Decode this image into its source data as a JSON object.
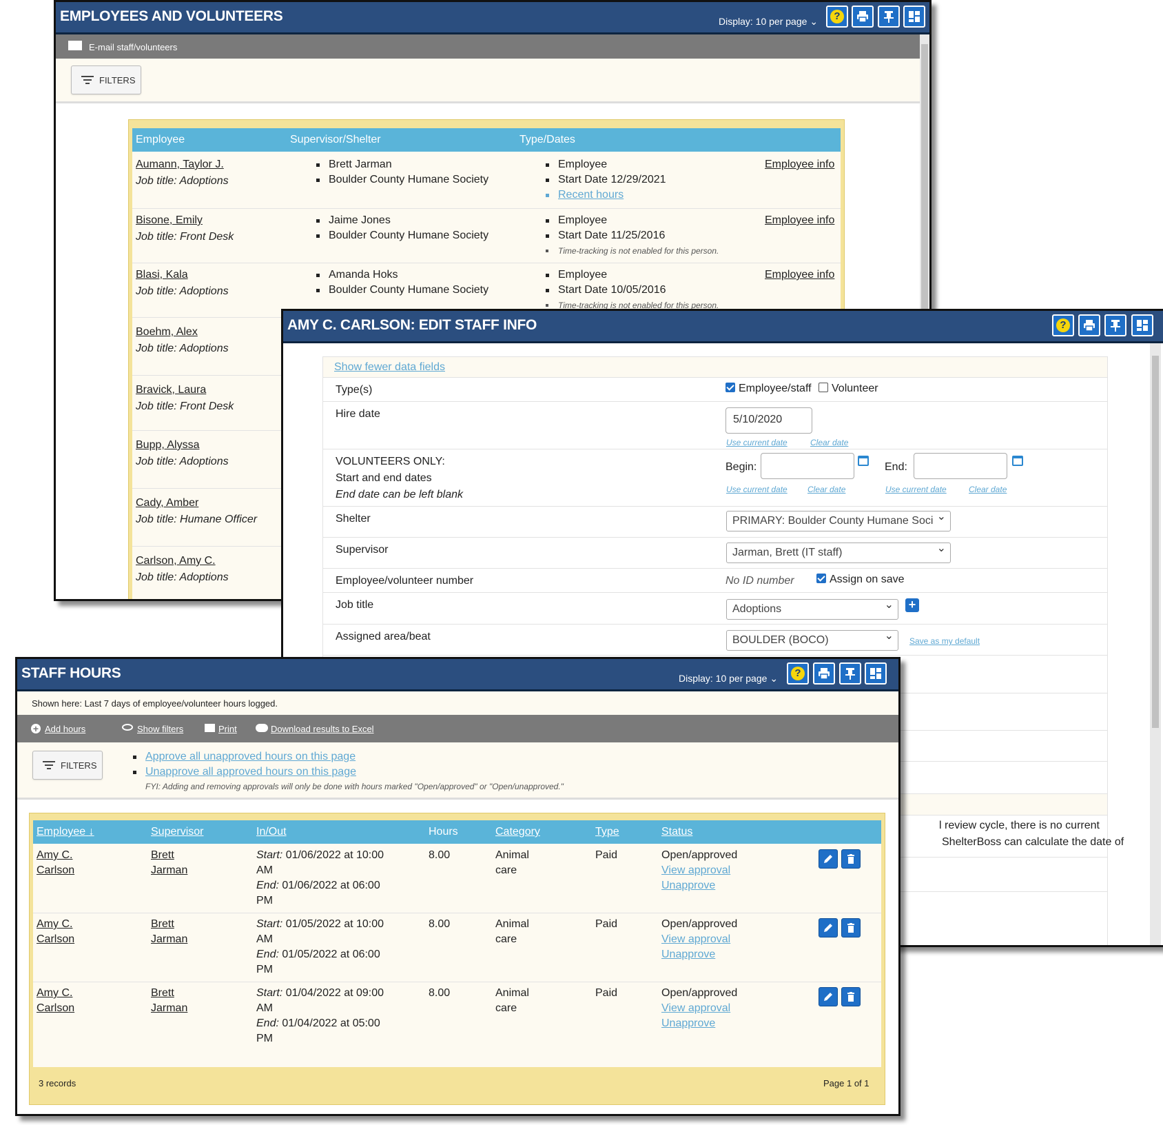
{
  "employees_window": {
    "title": "EMPLOYEES AND VOLUNTEERS",
    "display": "Display: 10 per page",
    "email_link": "E-mail staff/volunteers",
    "filters_label": "FILTERS",
    "columns": [
      "Employee",
      "Supervisor/Shelter",
      "Type/Dates"
    ],
    "rows": [
      {
        "name": "Aumann, Taylor J.",
        "job": "Job title: Adoptions",
        "supervisor": "Brett Jarman",
        "shelter": "Boulder County Humane Society",
        "type": "Employee",
        "start": "Start Date 12/29/2021",
        "extra": "Recent hours",
        "info": "Employee info"
      },
      {
        "name": "Bisone, Emily",
        "job": "Job title: Front Desk",
        "supervisor": "Jaime Jones",
        "shelter": "Boulder County Humane Society",
        "type": "Employee",
        "start": "Start Date 11/25/2016",
        "note": "Time-tracking is not enabled for this person.",
        "info": "Employee info"
      },
      {
        "name": "Blasi, Kala",
        "job": "Job title: Adoptions",
        "supervisor": "Amanda Hoks",
        "shelter": "Boulder County Humane Society",
        "type": "Employee",
        "start": "Start Date 10/05/2016",
        "note": "Time-tracking is not enabled for this person.",
        "info": "Employee info"
      },
      {
        "name": "Boehm, Alex",
        "job": "Job title: Adoptions"
      },
      {
        "name": "Bravick, Laura",
        "job": "Job title: Front Desk"
      },
      {
        "name": "Bupp, Alyssa",
        "job": "Job title: Adoptions"
      },
      {
        "name": "Cady, Amber",
        "job": "Job title: Humane Officer"
      },
      {
        "name": "Carlson, Amy C.",
        "job": "Job title: Adoptions"
      }
    ]
  },
  "edit_window": {
    "title": "AMY C. CARLSON: EDIT STAFF INFO",
    "show_fewer": "Show fewer data fields",
    "types_label": "Type(s)",
    "type_employee": "Employee/staff",
    "type_volunteer": "Volunteer",
    "hire_label": "Hire date",
    "hire_value": "5/10/2020",
    "use_current": "Use current date",
    "clear_date": "Clear date",
    "vol_line1": "VOLUNTEERS ONLY:",
    "vol_line2": "Start and end dates",
    "vol_line3": "End date can be left blank",
    "begin_label": "Begin:",
    "end_label": "End:",
    "shelter_label": "Shelter",
    "shelter_value": "PRIMARY: Boulder County Humane Soci",
    "supervisor_label": "Supervisor",
    "supervisor_value": "Jarman, Brett (IT staff)",
    "number_label": "Employee/volunteer number",
    "no_id": "No ID number",
    "assign_on_save": "Assign on save",
    "job_label": "Job title",
    "job_value": "Adoptions",
    "area_label": "Assigned area/beat",
    "area_value": "BOULDER (BOCO)",
    "save_default": "Save as my default",
    "review_line1": "l review cycle, there is no current",
    "review_line2": "ShelterBoss can calculate the date of"
  },
  "hours_window": {
    "title": "STAFF HOURS",
    "display": "Display: 10 per page",
    "shown_here": "Shown here: Last 7 days of employee/volunteer hours logged.",
    "toolbar": {
      "add": "Add hours",
      "filters": "Show filters",
      "print": "Print",
      "excel": "Download results to Excel"
    },
    "filters_label": "FILTERS",
    "approve_all": "Approve all unapproved hours on this page",
    "unapprove_all": "Unapprove all approved hours on this page",
    "fyi": "FYI: Adding and removing approvals will only be done with hours marked \"Open/approved\" or \"Open/unapproved.\"",
    "columns": {
      "employee": "Employee",
      "supervisor": "Supervisor",
      "inout": "In/Out",
      "hours": "Hours",
      "category": "Category",
      "type": "Type",
      "status": "Status"
    },
    "start_label": "Start:",
    "end_label": "End:",
    "rows": [
      {
        "emp1": "Amy C.",
        "emp2": "Carlson",
        "sup1": "Brett",
        "sup2": "Jarman",
        "start1": "01/06/2022 at 10:00",
        "start2": "AM",
        "end1": "01/06/2022 at 06:00",
        "end2": "PM",
        "hours": "8.00",
        "cat1": "Animal",
        "cat2": "care",
        "type": "Paid",
        "status": "Open/approved",
        "view": "View approval",
        "unapprove": "Unapprove"
      },
      {
        "emp1": "Amy C.",
        "emp2": "Carlson",
        "sup1": "Brett",
        "sup2": "Jarman",
        "start1": "01/05/2022 at 10:00",
        "start2": "AM",
        "end1": "01/05/2022 at 06:00",
        "end2": "PM",
        "hours": "8.00",
        "cat1": "Animal",
        "cat2": "care",
        "type": "Paid",
        "status": "Open/approved",
        "view": "View approval",
        "unapprove": "Unapprove"
      },
      {
        "emp1": "Amy C.",
        "emp2": "Carlson",
        "sup1": "Brett",
        "sup2": "Jarman",
        "start1": "01/04/2022 at 09:00",
        "start2": "AM",
        "end1": "01/04/2022 at 05:00",
        "end2": "PM",
        "hours": "8.00",
        "cat1": "Animal",
        "cat2": "care",
        "type": "Paid",
        "status": "Open/approved",
        "view": "View approval",
        "unapprove": "Unapprove"
      }
    ],
    "records": "3 records",
    "page": "Page 1 of 1"
  },
  "colors": {
    "titlebar": "#2b4e7f",
    "table_header": "#5ab4d9",
    "link": "#5fa8d3",
    "cream": "#fdfaf1",
    "frame": "#f4e39a"
  }
}
